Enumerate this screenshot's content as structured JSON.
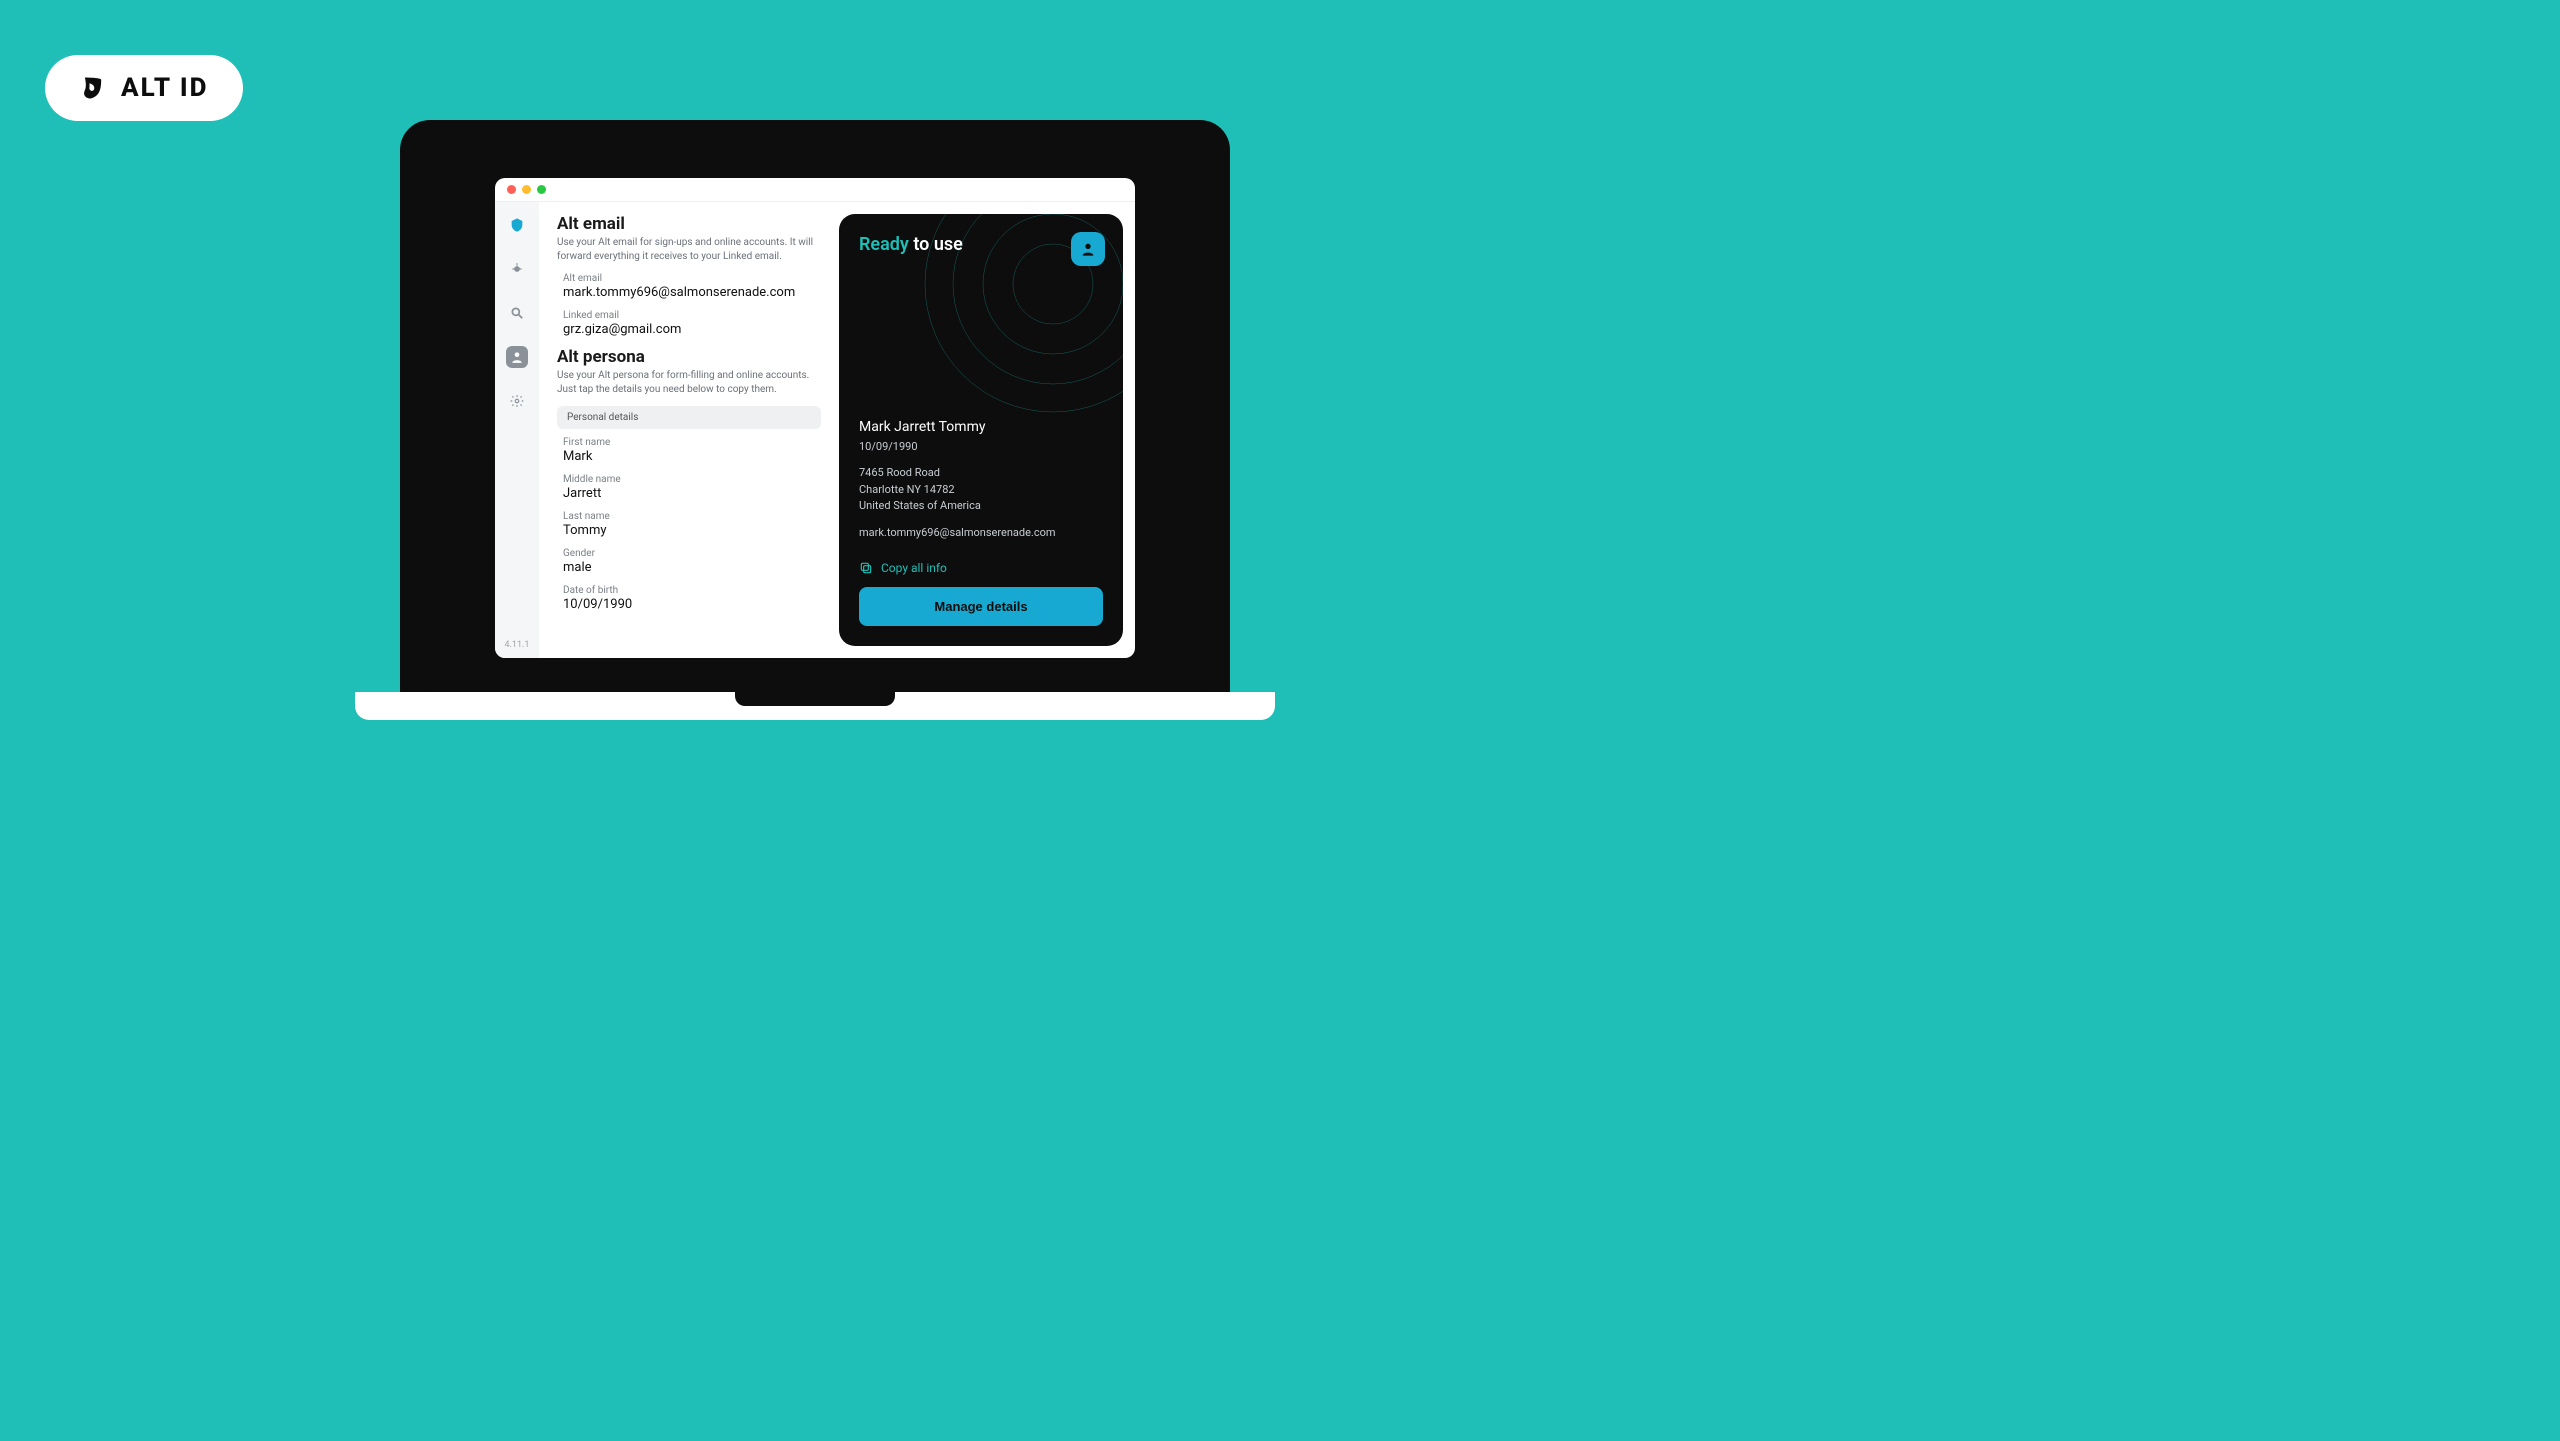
{
  "badge": {
    "label": "ALT ID"
  },
  "sidebar": {
    "version": "4.11.1"
  },
  "altEmail": {
    "title": "Alt email",
    "desc": "Use your Alt email for sign-ups and online accounts. It will forward everything it receives to your Linked email.",
    "altLabel": "Alt email",
    "altValue": "mark.tommy696@salmonserenade.com",
    "linkedLabel": "Linked email",
    "linkedValue": "grz.giza@gmail.com"
  },
  "altPersona": {
    "title": "Alt persona",
    "desc": "Use your Alt persona for form-filling and online accounts. Just tap the details you need below to copy them.",
    "subheader": "Personal details",
    "firstNameLabel": "First name",
    "firstName": "Mark",
    "middleNameLabel": "Middle name",
    "middleName": "Jarrett",
    "lastNameLabel": "Last name",
    "lastName": "Tommy",
    "genderLabel": "Gender",
    "gender": "male",
    "dobLabel": "Date of birth",
    "dob": "10/09/1990"
  },
  "card": {
    "readyLabel": "Ready",
    "toUseLabel": " to use",
    "name": "Mark Jarrett Tommy",
    "dob": "10/09/1990",
    "addr1": "7465 Rood Road",
    "addr2": "Charlotte NY 14782",
    "addr3": "United States of America",
    "email": "mark.tommy696@salmonserenade.com",
    "copyLabel": "Copy all info",
    "manageLabel": "Manage details"
  }
}
